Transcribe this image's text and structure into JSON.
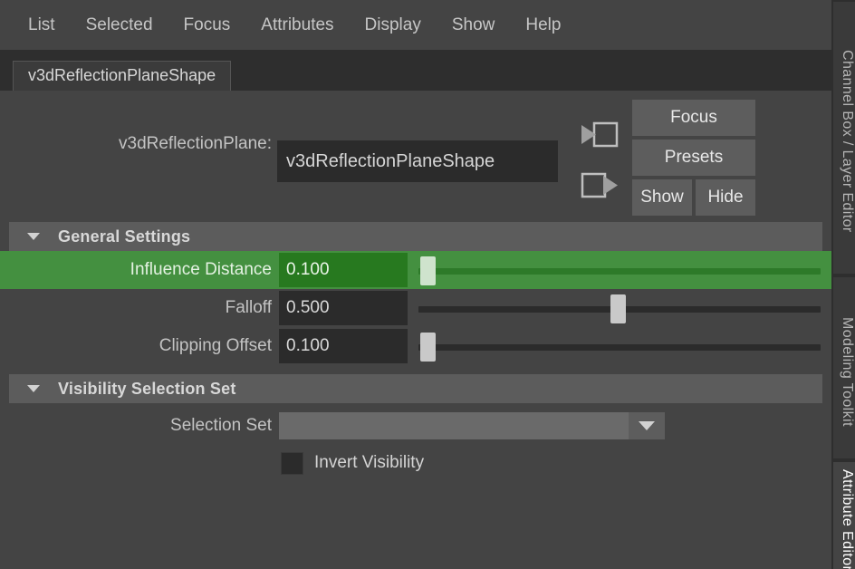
{
  "menubar": {
    "items": [
      {
        "label": "List"
      },
      {
        "label": "Selected"
      },
      {
        "label": "Focus"
      },
      {
        "label": "Attributes"
      },
      {
        "label": "Display"
      },
      {
        "label": "Show"
      },
      {
        "label": "Help"
      }
    ]
  },
  "tabstrip": {
    "active_tab": "v3dReflectionPlaneShape"
  },
  "node_header": {
    "label": "v3dReflectionPlane:",
    "name_value": "v3dReflectionPlaneShape",
    "name_placeholder": "",
    "icons": [
      {
        "name": "input-connection-icon"
      },
      {
        "name": "output-connection-icon"
      }
    ],
    "buttons": {
      "focus": "Focus",
      "presets": "Presets",
      "show": "Show",
      "hide": "Hide"
    }
  },
  "sections": [
    {
      "title": "General Settings",
      "expanded": true,
      "rows": [
        {
          "label": "Influence Distance",
          "value": "0.100",
          "slider_pct": 1.5,
          "highlighted": true
        },
        {
          "label": "Falloff",
          "value": "0.500",
          "slider_pct": 50,
          "highlighted": false
        },
        {
          "label": "Clipping Offset",
          "value": "0.100",
          "slider_pct": 1.5,
          "highlighted": false
        }
      ]
    }
  ],
  "visibility_section": {
    "title": "Visibility Selection Set",
    "expanded": true,
    "selection_set_label": "Selection Set",
    "selection_set_value": "",
    "invert_visibility_label": "Invert Visibility",
    "invert_visibility_checked": false
  },
  "rail": {
    "tabs": [
      {
        "label": "Channel Box / Layer Editor",
        "active": false
      },
      {
        "label": "Modeling Toolkit",
        "active": false
      },
      {
        "label": "Attribute Editor",
        "active": true
      }
    ]
  },
  "colors": {
    "background": "#444444",
    "panel_dark": "#2e2e2e",
    "field": "#2b2b2b",
    "section_header": "#5c5c5c",
    "button": "#5d5d5d",
    "highlight_green": "#449040",
    "highlight_green_field": "#27791f",
    "text": "#c8c8c8"
  }
}
